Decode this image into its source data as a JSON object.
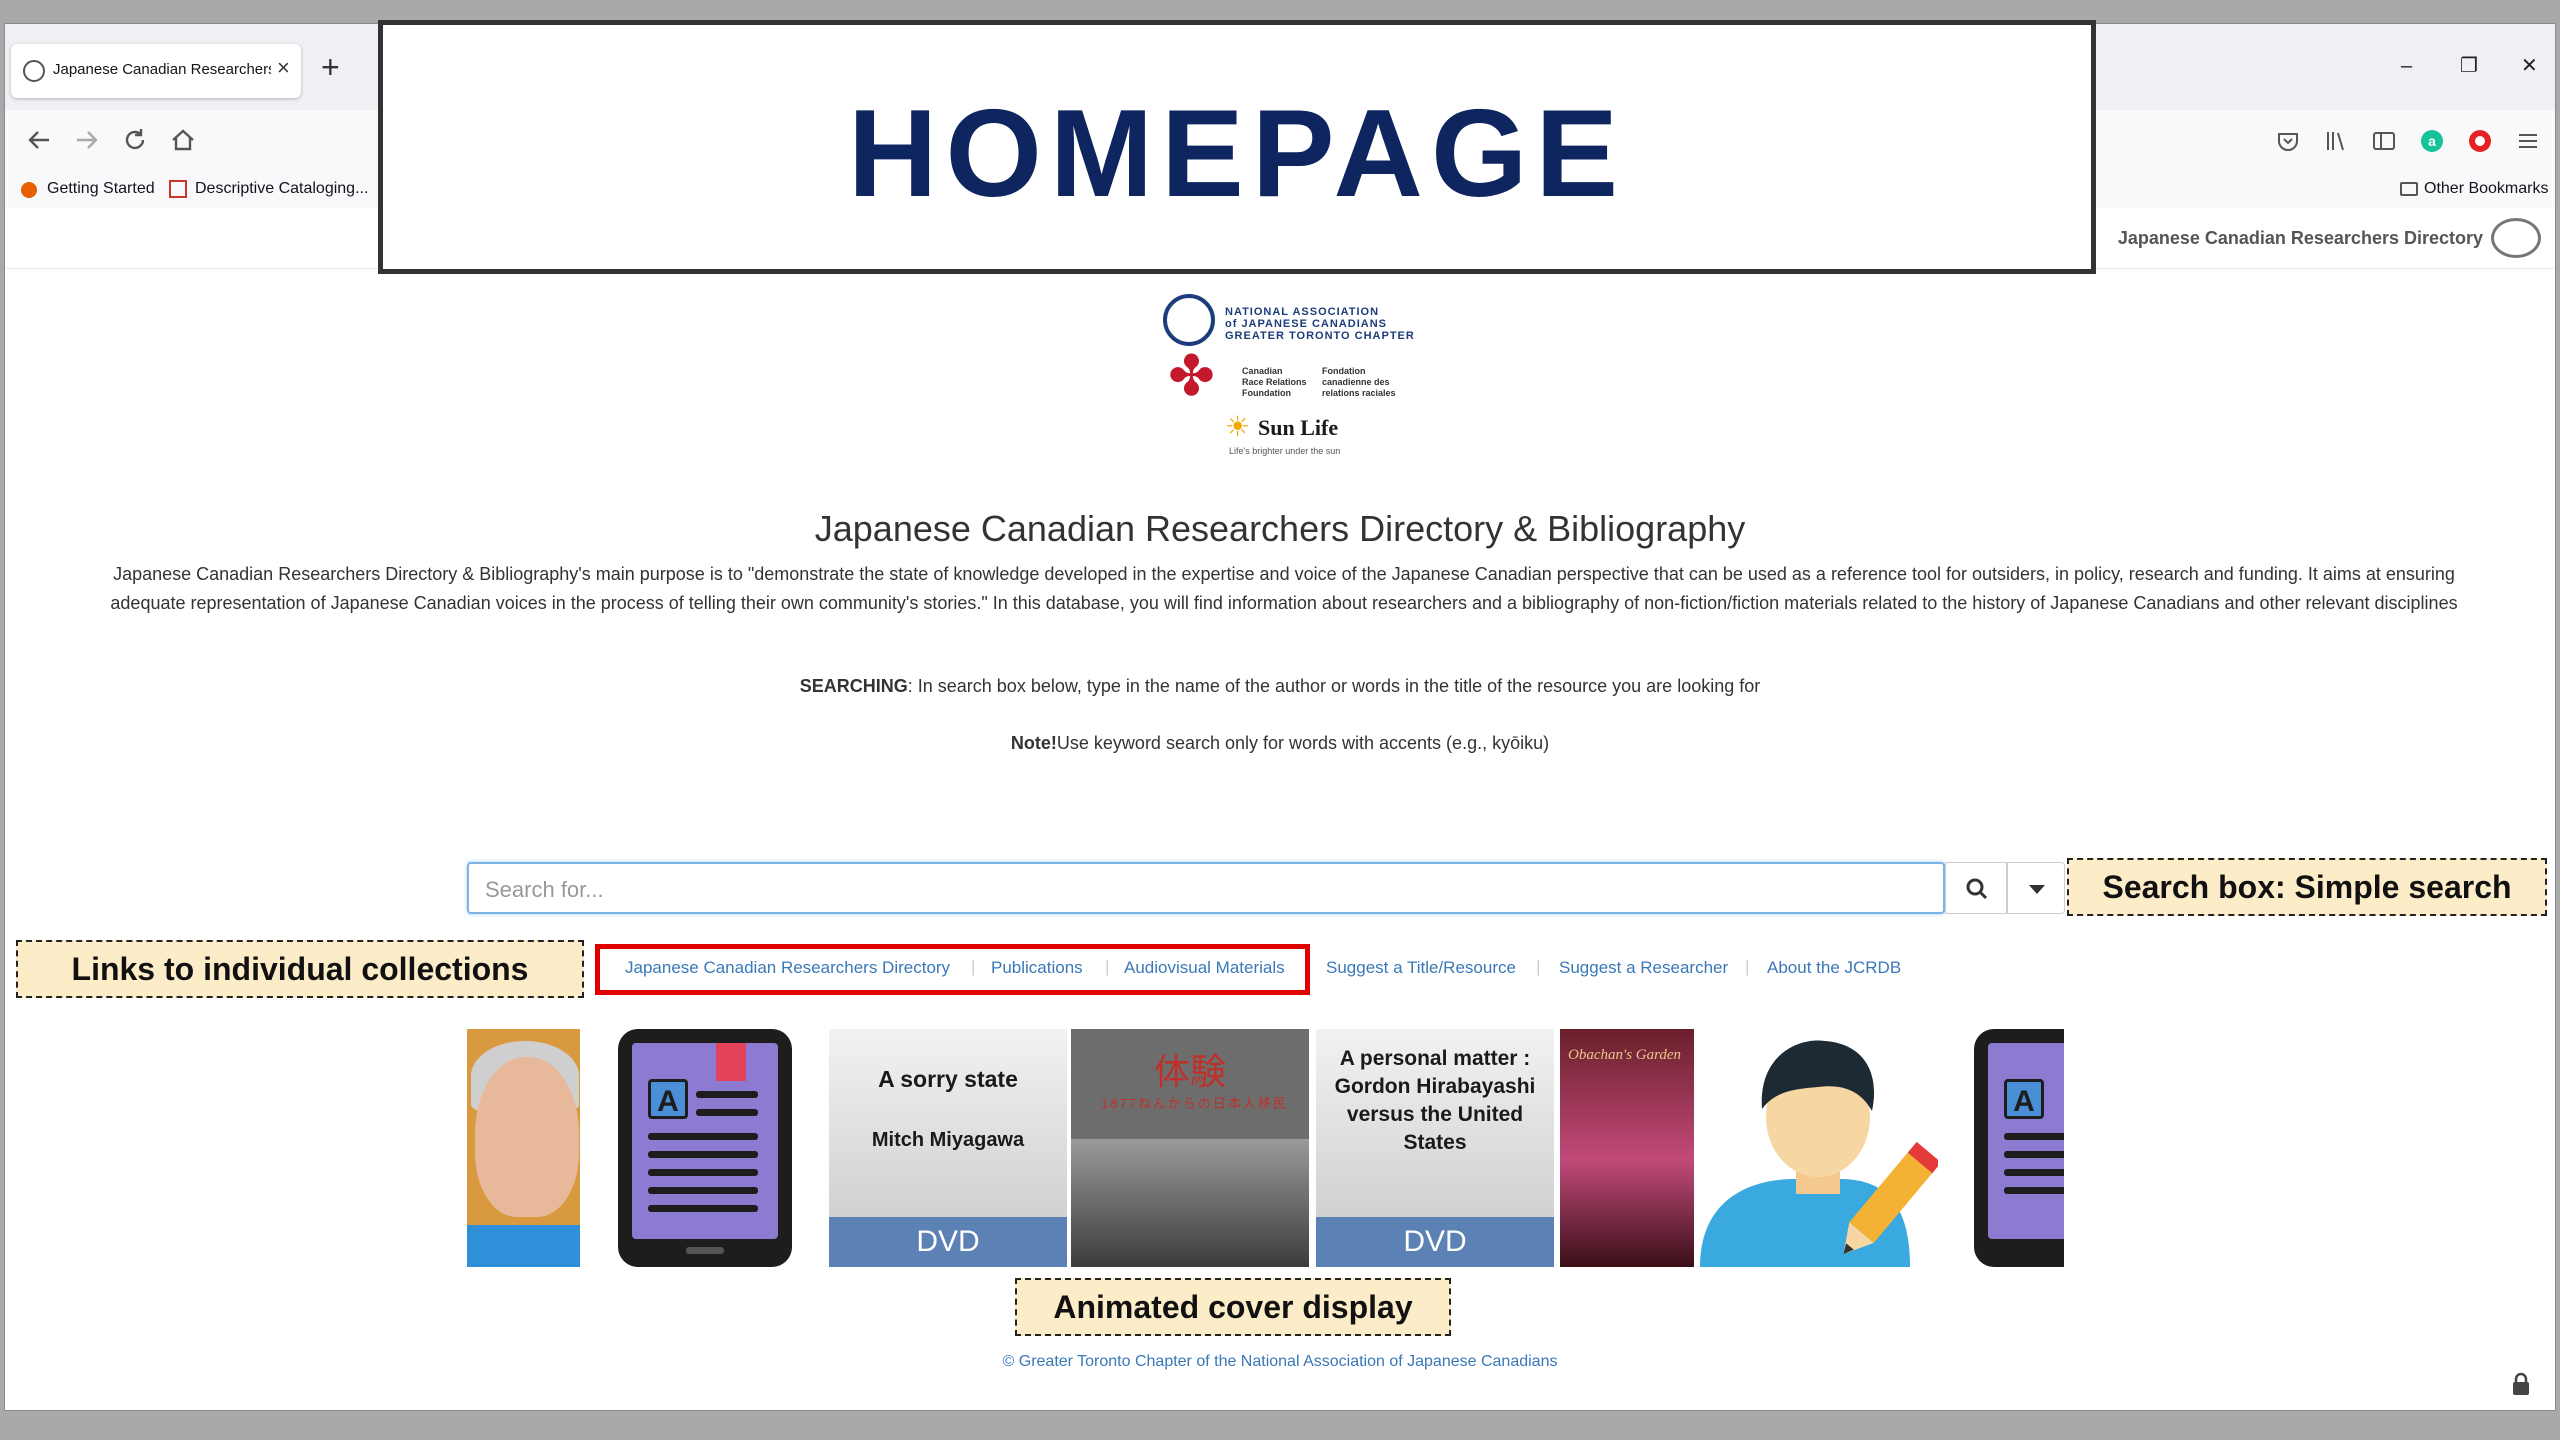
{
  "browser": {
    "tab_title": "Japanese Canadian Researchers",
    "tab_close": "×",
    "new_tab": "+",
    "window_controls": [
      "–",
      "❐",
      "✕"
    ],
    "bookmarks": [
      "Getting Started",
      "Descriptive Cataloging...",
      "Other Bookmarks"
    ]
  },
  "site": {
    "brand": "Japanese Canadian Researchers Directory",
    "title": "Japanese Canadian Researchers Directory & Bibliography",
    "intro": "Japanese Canadian Researchers Directory & Bibliography's main purpose is to \"demonstrate the state of knowledge developed in the expertise and voice of the Japanese Canadian perspective that can be used as a reference tool for outsiders, in policy, research and funding. It aims at ensuring adequate representation of Japanese Canadian voices in the process of telling their own community's stories.\" In this database, you will find information about researchers and a bibliography of non-fiction/fiction materials related to the history of Japanese Canadians and other relevant disciplines",
    "searching_label": "SEARCHING",
    "searching_text": ": In search box below, type in the name of the author or words in the title of the resource you are looking for",
    "note_label": "Note!",
    "note_text": "Use keyword search only for words with accents (e.g., kyōiku)",
    "footer": "© Greater Toronto Chapter of the National Association of Japanese Canadians"
  },
  "sponsors": {
    "naja": [
      "NATIONAL ASSOCIATION",
      "of JAPANESE CANADIANS",
      "GREATER TORONTO CHAPTER"
    ],
    "crr_en": [
      "Canadian",
      "Race Relations",
      "Foundation"
    ],
    "crr_fr": [
      "Fondation",
      "canadienne des",
      "relations raciales"
    ],
    "sunlife_name": "Sun Life",
    "sunlife_tagline": "Life's brighter under the sun"
  },
  "search": {
    "placeholder": "Search for..."
  },
  "links": {
    "directory": "Japanese Canadian Researchers Directory",
    "publications": "Publications",
    "audiovisual": "Audiovisual Materials",
    "suggest_title": "Suggest a Title/Resource",
    "suggest_researcher": "Suggest a Researcher",
    "about": "About the JCRDB",
    "separator": "|"
  },
  "covers": {
    "dvd1": {
      "title": "A sorry state",
      "author": "Mitch Miyagawa",
      "format": "DVD"
    },
    "dvd2": {
      "title": "A personal matter : Gordon Hirabayashi versus the United States",
      "format": "DVD"
    },
    "taiken": {
      "kanji": "体験",
      "subtitle": "1877ねんからの日本人移民"
    },
    "obaachan": {
      "title": "Obachan's Garden"
    }
  },
  "annotations": {
    "homepage": "HOMEPAGE",
    "search": "Search box: Simple search",
    "links": "Links to individual collections",
    "covers": "Animated cover display"
  },
  "colors": {
    "link": "#3a78b8",
    "highlight": "#e10000",
    "annotation_bg": "#fdecc8",
    "homepage_title": "#0f2560"
  }
}
